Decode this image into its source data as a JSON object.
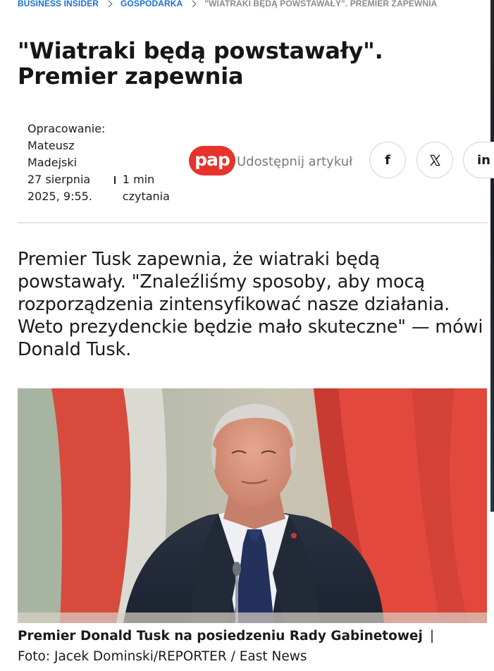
{
  "breadcrumb": {
    "items": [
      {
        "label": "BUSINESS INSIDER"
      },
      {
        "label": "GOSPODARKA"
      }
    ],
    "current": "\"WIATRAKI BĘDĄ POWSTAWAŁY\". PREMIER ZAPEWNIA"
  },
  "article": {
    "title": "\"Wiatraki będą powstawały\". Premier zapewnia",
    "author_label": "Opracowanie:",
    "author_name": "Mateusz Madejski",
    "date": "27 sierpnia 2025, 9:55.",
    "read_time": "1 min czytania",
    "source_logo_text": "pap",
    "lead": "Premier Tusk zapewnia, że wiatraki będą powstawały. \"Znaleźliśmy sposoby, aby mocą rozporządzenia zintensyfikować nasze działania. Weto prezydenckie będzie mało skuteczne\" — mówi Donald Tusk."
  },
  "share": {
    "label": "Udostępnij artykuł",
    "buttons": [
      {
        "icon": "facebook-icon",
        "glyph": "f"
      },
      {
        "icon": "x-icon",
        "glyph": "𝕏"
      },
      {
        "icon": "linkedin-icon",
        "glyph": "in"
      }
    ]
  },
  "photo": {
    "caption_title": "Premier Donald Tusk na posiedzeniu Rady Gabinetowej",
    "separator": "|",
    "credit": "Foto: Jacek Dominski/REPORTER / East News"
  },
  "colors": {
    "breadcrumb_link": "#1a6fd1",
    "breadcrumb_current": "#8b8b8b",
    "pap_red": "#e8322d",
    "flag_red": "#d8362e",
    "flag_green": "#8fa38f"
  }
}
